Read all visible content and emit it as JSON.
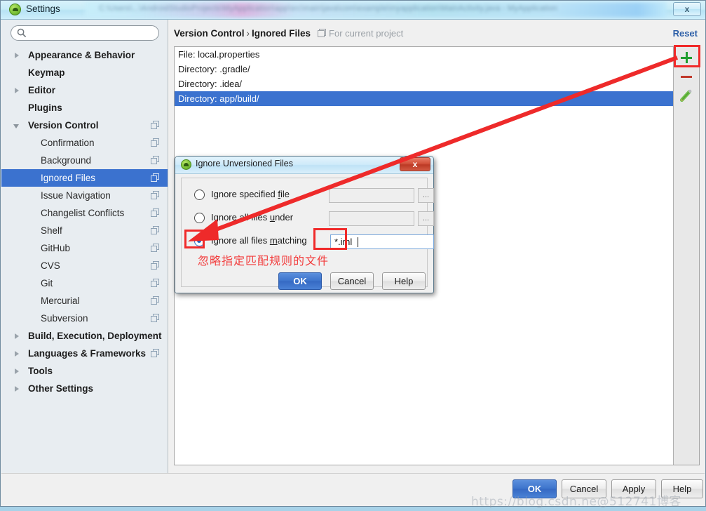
{
  "window": {
    "title": "Settings",
    "app_icon": "android-studio-icon",
    "close_label": "x",
    "blurred_path_text": "C:\\Users\\...\\AndroidStudioProjects\\MyApplication\\app\\src\\main\\java\\com\\example\\myapplication\\MainActivity.java - MyApplication"
  },
  "sidebar": {
    "search": {
      "value": "",
      "placeholder": "",
      "icon": "search-icon"
    },
    "items": [
      {
        "label": "Appearance & Behavior",
        "level": "top",
        "expander": "right",
        "copy_icon": false,
        "selected": false
      },
      {
        "label": "Keymap",
        "level": "top",
        "expander": "none",
        "copy_icon": false,
        "selected": false
      },
      {
        "label": "Editor",
        "level": "top",
        "expander": "right",
        "copy_icon": false,
        "selected": false
      },
      {
        "label": "Plugins",
        "level": "top",
        "expander": "none",
        "copy_icon": false,
        "selected": false
      },
      {
        "label": "Version Control",
        "level": "top",
        "expander": "down",
        "copy_icon": true,
        "selected": false
      },
      {
        "label": "Confirmation",
        "level": "child",
        "expander": "none",
        "copy_icon": true,
        "selected": false
      },
      {
        "label": "Background",
        "level": "child",
        "expander": "none",
        "copy_icon": true,
        "selected": false
      },
      {
        "label": "Ignored Files",
        "level": "child",
        "expander": "none",
        "copy_icon": true,
        "selected": true
      },
      {
        "label": "Issue Navigation",
        "level": "child",
        "expander": "none",
        "copy_icon": true,
        "selected": false
      },
      {
        "label": "Changelist Conflicts",
        "level": "child",
        "expander": "none",
        "copy_icon": true,
        "selected": false
      },
      {
        "label": "Shelf",
        "level": "child",
        "expander": "none",
        "copy_icon": true,
        "selected": false
      },
      {
        "label": "GitHub",
        "level": "child",
        "expander": "none",
        "copy_icon": true,
        "selected": false
      },
      {
        "label": "CVS",
        "level": "child",
        "expander": "none",
        "copy_icon": true,
        "selected": false
      },
      {
        "label": "Git",
        "level": "child",
        "expander": "none",
        "copy_icon": true,
        "selected": false
      },
      {
        "label": "Mercurial",
        "level": "child",
        "expander": "none",
        "copy_icon": true,
        "selected": false
      },
      {
        "label": "Subversion",
        "level": "child",
        "expander": "none",
        "copy_icon": true,
        "selected": false
      },
      {
        "label": "Build, Execution, Deployment",
        "level": "top",
        "expander": "right",
        "copy_icon": false,
        "selected": false
      },
      {
        "label": "Languages & Frameworks",
        "level": "top",
        "expander": "right",
        "copy_icon": true,
        "selected": false
      },
      {
        "label": "Tools",
        "level": "top",
        "expander": "right",
        "copy_icon": false,
        "selected": false
      },
      {
        "label": "Other Settings",
        "level": "top",
        "expander": "right",
        "copy_icon": false,
        "selected": false
      }
    ]
  },
  "main": {
    "breadcrumb": {
      "parent": "Version Control",
      "separator": "›",
      "current": "Ignored Files"
    },
    "scope_note": "For current project",
    "reset_label": "Reset",
    "ignored_files": [
      {
        "text": "File: local.properties",
        "selected": false
      },
      {
        "text": "Directory: .gradle/",
        "selected": false
      },
      {
        "text": "Directory: .idea/",
        "selected": false
      },
      {
        "text": "Directory: app/build/",
        "selected": true
      }
    ],
    "toolbar": {
      "add_icon": "plus-icon",
      "remove_icon": "minus-icon",
      "edit_icon": "pencil-icon"
    }
  },
  "footer": {
    "ok": "OK",
    "cancel": "Cancel",
    "apply": "Apply",
    "help": "Help"
  },
  "dialog": {
    "title": "Ignore Unversioned Files",
    "close_label": "x",
    "options": [
      {
        "label_prefix": "Ignore specified ",
        "label_mnemonic": "f",
        "label_suffix": "ile",
        "selected": false,
        "field_value": "",
        "has_browse": true,
        "browse_label": "..."
      },
      {
        "label_prefix": "Ignore all files ",
        "label_mnemonic": "u",
        "label_suffix": "nder",
        "selected": false,
        "field_value": "",
        "has_browse": true,
        "browse_label": "..."
      },
      {
        "label_prefix": "Ignore all files ",
        "label_mnemonic": "m",
        "label_suffix": "atching",
        "selected": true,
        "field_value": "*.iml",
        "has_browse": false,
        "browse_label": ""
      }
    ],
    "buttons": {
      "ok": "OK",
      "cancel": "Cancel",
      "help": "Help"
    }
  },
  "annotations": {
    "chinese_note": "忽略指定匹配规则的文件",
    "highlight_color": "#f02a2a",
    "arrow_color": "#ee2a2a",
    "watermark": "https://blog.csdn.ne@512741博客"
  },
  "colors": {
    "selection_blue": "#3b72cf",
    "accent_green": "#1f9e2f",
    "accent_red": "#c0392b",
    "link_blue": "#2d5fa8"
  }
}
